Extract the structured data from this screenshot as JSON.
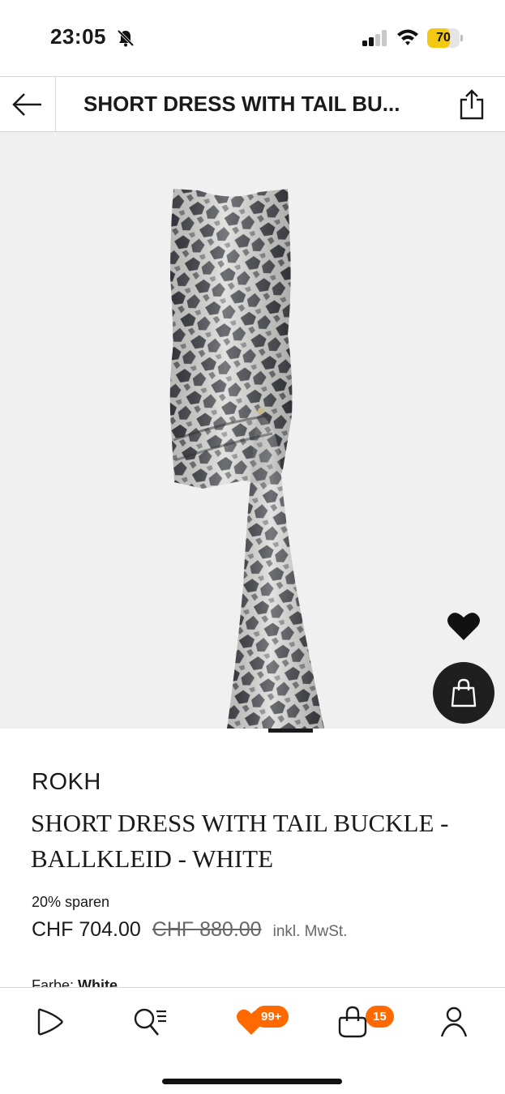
{
  "status_bar": {
    "time": "23:05",
    "battery_level": "70",
    "battery_color": "#f2c811",
    "icons": [
      "bell-muted-icon",
      "signal-icon",
      "wifi-icon",
      "battery-icon"
    ]
  },
  "header": {
    "title": "SHORT DRESS WITH TAIL BU...",
    "icons": [
      "back-arrow-icon",
      "share-icon"
    ]
  },
  "gallery": {
    "icons": [
      "heart-icon",
      "shopping-bag-icon"
    ],
    "background": "#f0f0f0"
  },
  "product": {
    "brand": "ROKH",
    "name": "SHORT DRESS WITH TAIL BUCKLE - BALLKLEID - WHITE",
    "discount": "20% sparen",
    "price_current": "CHF 704.00",
    "price_original": "CHF 880.00",
    "tax_note": "inkl. MwSt.",
    "color_label": "Farbe:",
    "color_value": "White"
  },
  "bottom_nav": {
    "items": [
      {
        "name": "play",
        "icon": "play-icon"
      },
      {
        "name": "search",
        "icon": "search-icon"
      },
      {
        "name": "wishlist",
        "icon": "heart-icon",
        "badge": "99+"
      },
      {
        "name": "bag",
        "icon": "bag-icon",
        "badge": "15"
      },
      {
        "name": "account",
        "icon": "user-icon"
      }
    ],
    "accent_color": "#ff6900"
  }
}
